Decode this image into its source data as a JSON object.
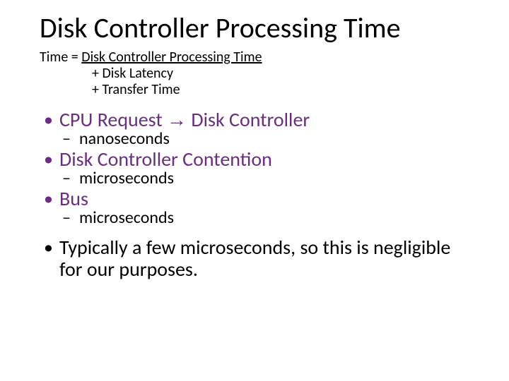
{
  "title": "Disk Controller Processing Time",
  "formula": {
    "line1_lhs": "Time = ",
    "line1_rhs": "Disk Controller Processing Time",
    "line2": "+ Disk Latency",
    "line3": "+ Transfer Time"
  },
  "items": [
    {
      "label_pre": "CPU Request ",
      "arrow": "→",
      "label_post": " Disk Controller",
      "sub": "nanoseconds"
    },
    {
      "label_pre": "Disk Controller Contention",
      "arrow": "",
      "label_post": "",
      "sub": "microseconds"
    },
    {
      "label_pre": "Bus",
      "arrow": "",
      "label_post": "",
      "sub": "microseconds"
    }
  ],
  "conclusion": "Typically a few microseconds, so this is negligible for our purposes."
}
